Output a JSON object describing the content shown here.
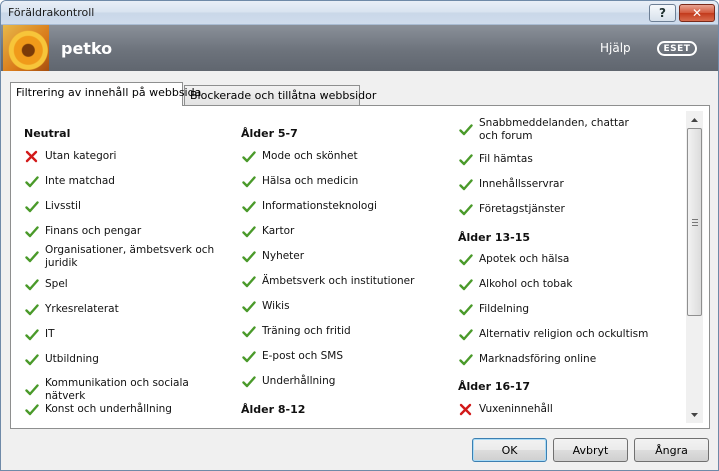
{
  "window": {
    "title": "Föräldrakontroll",
    "help_button": "?",
    "close_button": "✕"
  },
  "header": {
    "username": "petko",
    "help_link": "Hjälp",
    "brand": "ESET"
  },
  "tabs": [
    {
      "label": "Filtrering av innehåll på webbsida",
      "active": true
    },
    {
      "label": "Blockerade och tillåtna webbsidor",
      "active": false
    }
  ],
  "columns": {
    "col1": {
      "heading": "Neutral",
      "items": [
        {
          "label": "Utan kategori",
          "status": "blocked"
        },
        {
          "label": "Inte matchad",
          "status": "allowed"
        },
        {
          "label": "Livsstil",
          "status": "allowed"
        },
        {
          "label": "Finans och pengar",
          "status": "allowed"
        },
        {
          "label": "Organisationer, ämbetsverk och juridik",
          "status": "allowed"
        },
        {
          "label": "Spel",
          "status": "allowed"
        },
        {
          "label": "Yrkesrelaterat",
          "status": "allowed"
        },
        {
          "label": "IT",
          "status": "allowed"
        },
        {
          "label": "Utbildning",
          "status": "allowed"
        },
        {
          "label": "Kommunikation och sociala nätverk",
          "status": "allowed"
        },
        {
          "label": "Konst och underhållning",
          "status": "allowed"
        }
      ]
    },
    "col2": {
      "heading": "Ålder 5-7",
      "items": [
        {
          "label": "Mode och skönhet",
          "status": "allowed"
        },
        {
          "label": "Hälsa och medicin",
          "status": "allowed"
        },
        {
          "label": "Informationsteknologi",
          "status": "allowed"
        },
        {
          "label": "Kartor",
          "status": "allowed"
        },
        {
          "label": "Nyheter",
          "status": "allowed"
        },
        {
          "label": "Ämbetsverk och institutioner",
          "status": "allowed"
        },
        {
          "label": "Wikis",
          "status": "allowed"
        },
        {
          "label": "Träning och fritid",
          "status": "allowed"
        },
        {
          "label": "E-post och SMS",
          "status": "allowed"
        },
        {
          "label": "Underhållning",
          "status": "allowed"
        }
      ],
      "heading2": "Ålder 8-12"
    },
    "col3": {
      "items_top": [
        {
          "label": "Snabbmeddelanden, chattar och forum",
          "status": "allowed"
        },
        {
          "label": "Fil hämtas",
          "status": "allowed"
        },
        {
          "label": "Innehållsservrar",
          "status": "allowed"
        },
        {
          "label": "Företagstjänster",
          "status": "allowed"
        }
      ],
      "heading_a": "Ålder 13-15",
      "items_mid": [
        {
          "label": "Apotek och hälsa",
          "status": "allowed"
        },
        {
          "label": "Alkohol och tobak",
          "status": "allowed"
        },
        {
          "label": "Fildelning",
          "status": "allowed"
        },
        {
          "label": "Alternativ religion och ockultism",
          "status": "allowed"
        },
        {
          "label": "Marknadsföring online",
          "status": "allowed"
        }
      ],
      "heading_b": "Ålder 16-17",
      "items_bottom": [
        {
          "label": "Vuxeninnehåll",
          "status": "blocked"
        }
      ]
    }
  },
  "scrollbar": {
    "position_fraction": 0.0
  },
  "buttons": {
    "ok": "OK",
    "cancel": "Avbryt",
    "undo": "Ångra"
  },
  "colors": {
    "allowed": "#4a9a2a",
    "blocked": "#d21a1a",
    "header_bg": "#6d737c"
  }
}
